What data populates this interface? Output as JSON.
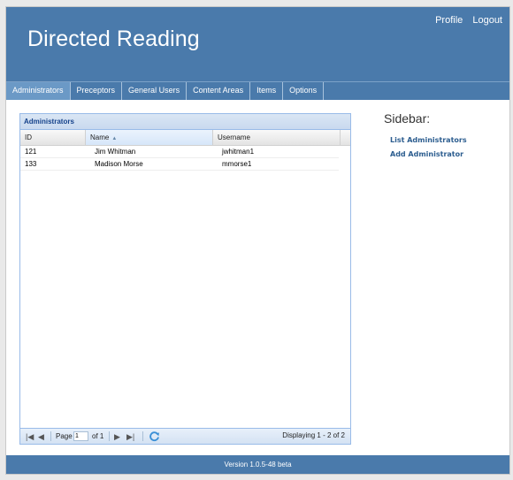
{
  "header": {
    "title": "Directed Reading",
    "links": [
      "Profile",
      "Logout"
    ]
  },
  "nav": {
    "tabs": [
      "Administrators",
      "Preceptors",
      "General Users",
      "Content Areas",
      "Items",
      "Options"
    ],
    "active": "Administrators"
  },
  "grid": {
    "title": "Administrators",
    "columns": [
      "ID",
      "Name",
      "Username"
    ],
    "sorted_column": "Name",
    "rows": [
      [
        "121",
        "Jim Whitman",
        "jwhitman1"
      ],
      [
        "133",
        "Madison Morse",
        "mmorse1"
      ]
    ],
    "paging": {
      "page_label": "Page",
      "page_value": "1",
      "of_label": "of 1",
      "displaying": "Displaying 1 - 2 of 2"
    }
  },
  "sidebar": {
    "title": "Sidebar:",
    "links": [
      "List Administrators",
      "Add Administrator"
    ]
  },
  "footer": {
    "version": "Version 1.0.5-48 beta"
  },
  "colors": {
    "header_bg": "#4a7aab",
    "active_tab": "#6b99c6",
    "link": "#2c5d8f",
    "grid_border": "#99bbe8"
  }
}
